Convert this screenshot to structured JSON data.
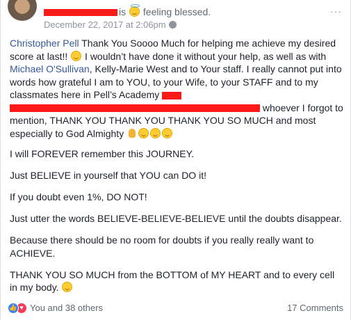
{
  "header": {
    "name_suffix": "is",
    "feeling_text": "feeling blessed.",
    "date": "December 22, 2017 at 2:06pm",
    "more": "···"
  },
  "post": {
    "mention_1": "Christopher Pell",
    "p1_a": " Thank You Soooo Much for helping me achieve my desired score at last!! ",
    "p1_b": " I wouldn’t have done it without your help, as well as with ",
    "mention_2": "Michael O'Sullivan",
    "p1_c": ", Kelly-Marie West and to Your staff. I really cannot put into words how grateful I am to YOU, to your Wife, to your STAFF and to my classmates here in Pell’s Academy ",
    "p1_d": " whoever I forgot to mention, THANK YOU THANK YOU THANK YOU SO MUCH and most especially to God Almighty ",
    "p2": "I will FOREVER remember this JOURNEY.",
    "p3": "Just BELIEVE in yourself that YOU can DO it!",
    "p4": "If you doubt even 1%, DO NOT!",
    "p5": "Just utter the words BELIEVE-BELIEVE-BELIEVE until the doubts disappear.",
    "p6": "Because there should be no room for doubts if you really really want to ACHIEVE.",
    "p7": "THANK YOU SO MUCH from the BOTTOM of MY HEART and to every cell in my body. "
  },
  "footer": {
    "likes": "You and 38 others",
    "comments": "17 Comments"
  },
  "colors": {
    "link": "#365899",
    "redaction": "#ff1a1a",
    "like": "#3b82f6",
    "love": "#f33e58"
  },
  "icons": [
    "globe-icon",
    "more-icon",
    "like-icon",
    "love-icon",
    "smile-emoji",
    "halo-emoji",
    "pray-emoji",
    "hug-emoji"
  ]
}
